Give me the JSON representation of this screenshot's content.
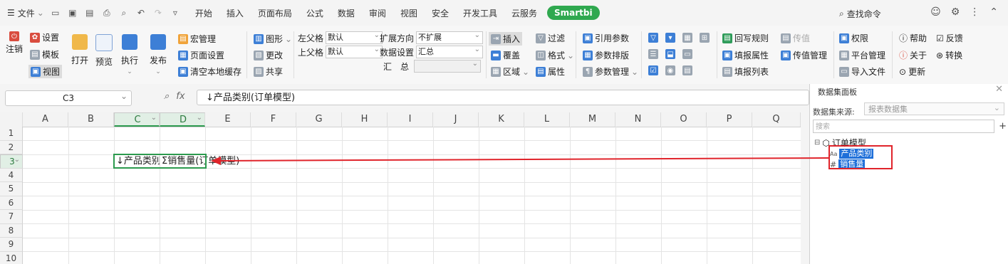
{
  "menubar": {
    "file": "文件",
    "tabs": [
      "开始",
      "插入",
      "页面布局",
      "公式",
      "数据",
      "审阅",
      "视图",
      "安全",
      "开发工具",
      "云服务"
    ],
    "smartbi": "Smartbi",
    "search_cmd": "查找命令"
  },
  "ribbon": {
    "logout": "注销",
    "settings": "设置",
    "template": "模板",
    "view": "视图",
    "open": "打开",
    "preview": "预览",
    "execute": "执行",
    "publish": "发布",
    "macro": "宏管理",
    "page_setup": "页面设置",
    "clear_cache": "清空本地缓存",
    "graph": "图形",
    "change": "更改",
    "share": "共享",
    "left_parent_label": "左父格",
    "left_parent_value": "默认",
    "top_parent_label": "上父格",
    "top_parent_value": "默认",
    "expand_dir_label": "扩展方向",
    "expand_dir_value": "不扩展",
    "data_setting_label": "数据设置",
    "data_setting_value": "汇总",
    "summary_label": "汇　总",
    "insert": "插入",
    "overwrite": "覆盖",
    "area": "区域",
    "filter": "过滤",
    "format": "格式",
    "attribute": "属性",
    "ref_param": "引用参数",
    "param_layout": "参数排版",
    "param_mgmt": "参数管理",
    "writeback_rules": "回写规则",
    "fill_attr": "填报属性",
    "fill_list": "填报列表",
    "pass_value": "传值",
    "pass_value_mgmt": "传值管理",
    "permission": "权限",
    "platform_mgmt": "平台管理",
    "import_file": "导入文件",
    "help": "帮助",
    "feedback": "反馈",
    "about": "关于",
    "convert": "转换",
    "update": "更新"
  },
  "formula_bar": {
    "cell_ref": "C3",
    "fx": "fx",
    "content": "↓产品类别(订单模型)"
  },
  "grid": {
    "columns": [
      "A",
      "B",
      "C",
      "D",
      "E",
      "F",
      "G",
      "H",
      "I",
      "J",
      "K",
      "L",
      "M",
      "N",
      "O",
      "P",
      "Q"
    ],
    "rows": [
      "1",
      "2",
      "3",
      "4",
      "5",
      "6",
      "7",
      "8",
      "9",
      "10"
    ],
    "c3": "↓产品类别(订单模型)",
    "d3": "Σ销售量(订单模型)"
  },
  "panel": {
    "title": "数据集面板",
    "source_label": "数据集来源:",
    "source_value": "报表数据集",
    "search_placeholder": "搜索",
    "root": "订单模型",
    "fields": [
      {
        "type": "Aa",
        "name": "产品类别"
      },
      {
        "type": "#",
        "name": "销售量"
      }
    ]
  },
  "colors": {
    "accent_green": "#2c9a4e",
    "smartbi_green": "#2fa84f",
    "highlight_red": "#e0242b",
    "selection_blue": "#1e6fd9"
  }
}
